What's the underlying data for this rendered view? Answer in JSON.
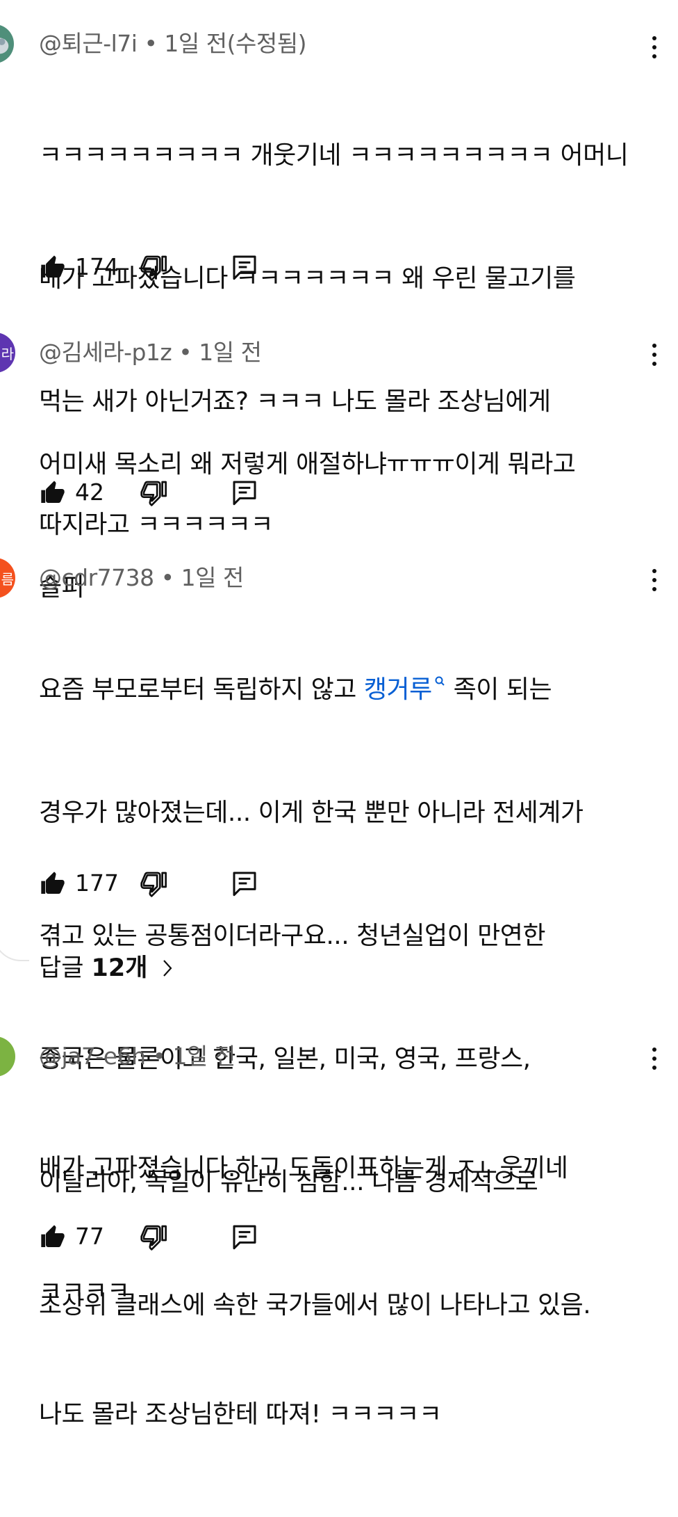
{
  "comments": [
    {
      "author": "@퇴근-l7i",
      "time": "1일 전(수정됨)",
      "lines": [
        "ㅋㅋㅋㅋㅋㅋㅋㅋㅋ 개웃기네 ㅋㅋㅋㅋㅋㅋㅋㅋㅋ 어머니",
        "배가 고파졌습니다 ㅋㅋㅋㅋㅋㅋㅋ 왜 우린 물고기를",
        "먹는 새가 아닌거죠? ㅋㅋㅋ 나도 몰라 조상님에게",
        "따지라고 ㅋㅋㅋㅋㅋㅋ"
      ],
      "likes": "174",
      "avatar_color": "#4f8f7a"
    },
    {
      "author": "@김세라-p1z",
      "time": "1일 전",
      "lines": [
        "어미새 목소리 왜 저렇게 애절하냐ㅠㅠㅠ이게 뭐라고",
        "슬퍼"
      ],
      "likes": "42",
      "avatar_color": "#5e35b1",
      "avatar_text": "라"
    },
    {
      "author": "@cdr7738",
      "time": "1일 전",
      "line1_pre": "요즘 부모로부터 독립하지 않고 ",
      "line1_link": "캥거루",
      "line1_post": " 족이 되는",
      "lines": [
        "경우가 많아졌는데... 이게 한국 뿐만 아니라 전세계가",
        "겪고 있는 공통점이더라구요... 청년실업이 만연한",
        "중국은 물론이고 한국, 일본, 미국, 영국, 프랑스,",
        "이탈리아, 독일이 유난히 심함... 나름 경제적으로",
        "초상위 클래스에 속한 국가들에서 많이 나타나고 있음."
      ],
      "likes": "177",
      "avatar_color": "#f4511e",
      "avatar_text": "름",
      "replies_prefix": "답글 ",
      "replies_count": "12개"
    },
    {
      "author": "@ja7-e6h",
      "time": "1일 전",
      "lines": [
        "배가 고파졌습니다.하고 도돌이표하는게 ㅈㄴ웃끼네",
        "ㅋㅋㅋㅋ",
        "나도 몰라 조상님한테 따져! ㅋㅋㅋㅋㅋ"
      ],
      "likes": "77",
      "avatar_color": "#7cb342"
    }
  ],
  "separator": " • ",
  "icons": {
    "like": "thumb-up-icon",
    "dislike": "thumb-down-icon",
    "reply": "reply-comment-icon",
    "more": "more-vert-icon",
    "chevron": "chevron-right-icon",
    "search": "search-small-icon"
  }
}
